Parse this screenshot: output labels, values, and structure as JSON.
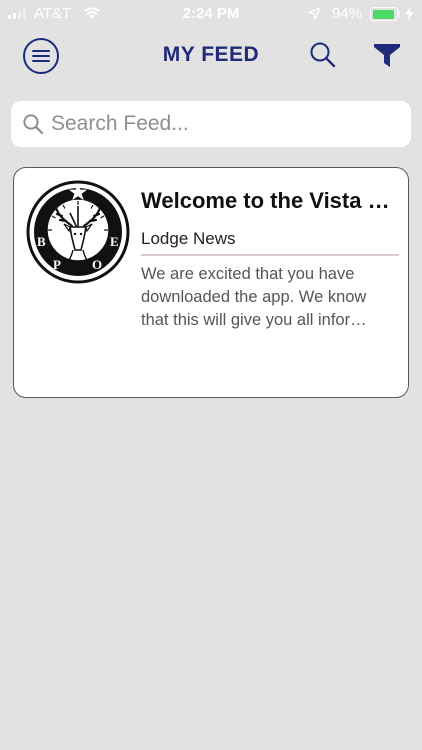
{
  "status_bar": {
    "carrier": "AT&T",
    "time": "2:24 PM",
    "battery_percent": "94%",
    "battery_level": 0.94,
    "icons": [
      "signal-bars-icon",
      "wifi-icon",
      "location-arrow-icon",
      "battery-icon",
      "charging-bolt-icon"
    ]
  },
  "nav": {
    "title": "MY FEED",
    "menu_icon": "hamburger-circle-icon",
    "search_icon": "search-icon",
    "filter_icon": "filter-funnel-icon"
  },
  "search": {
    "placeholder": "Search Feed...",
    "value": ""
  },
  "feed": {
    "items": [
      {
        "title": "Welcome to the Vista Lodge App",
        "category": "Lodge News",
        "excerpt": "We are excited that you have\ndownloaded the app.  We know\nthat this will give you all infor…",
        "logo": "bpoe-elk-emblem"
      }
    ]
  },
  "colors": {
    "accent": "#1f2b7a",
    "background": "#e2e2e2",
    "card": "#ffffff",
    "divider": "#d7c9cd",
    "battery": "#4cd964"
  }
}
